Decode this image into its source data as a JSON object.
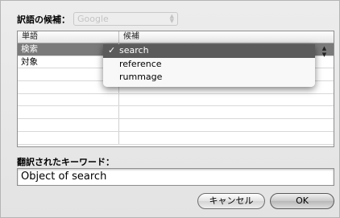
{
  "header": {
    "label": "訳語の候補：",
    "engine": "Google"
  },
  "table": {
    "columns": [
      "単語",
      "候補"
    ],
    "rows": [
      {
        "word": "検索",
        "candidate": "search",
        "selected": true
      },
      {
        "word": "対象",
        "candidate": "",
        "selected": false
      }
    ]
  },
  "menu": {
    "items": [
      {
        "label": "search",
        "checked": true,
        "check": "✓"
      },
      {
        "label": "reference",
        "checked": false
      },
      {
        "label": "rummage",
        "checked": false
      }
    ]
  },
  "keyword": {
    "label": "翻訳されたキーワード：",
    "value": "Object of search"
  },
  "buttons": {
    "cancel": "キャンセル",
    "ok": "OK"
  },
  "icons": {
    "stepper_up": "▲",
    "stepper_down": "▼",
    "check": "checkmark-icon"
  }
}
